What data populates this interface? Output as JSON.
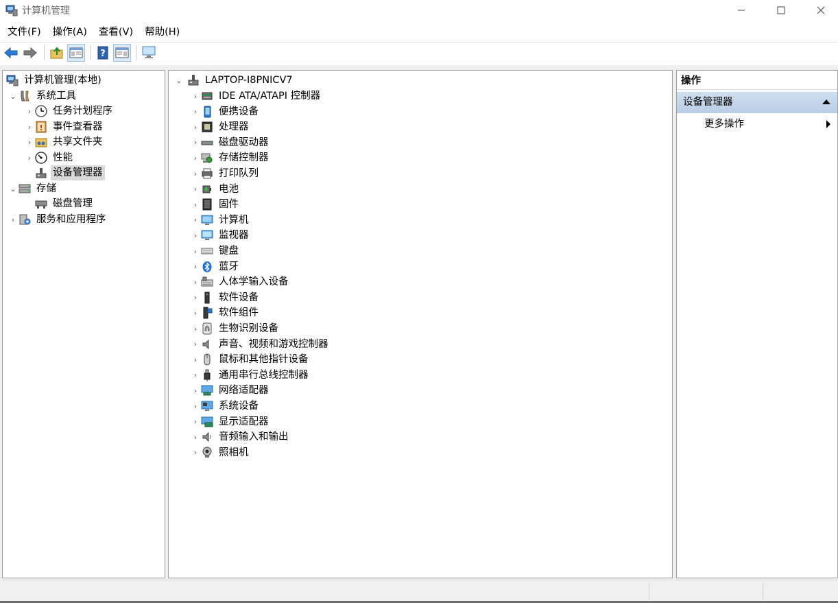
{
  "window": {
    "title": "计算机管理",
    "controls": {
      "minimize": "—",
      "maximize": "☐",
      "close": "✕"
    }
  },
  "menu": {
    "items": [
      "文件(F)",
      "操作(A)",
      "查看(V)",
      "帮助(H)"
    ]
  },
  "toolbar": {
    "buttons": [
      "back-icon",
      "forward-icon",
      "up-folder-icon",
      "show-hide-tree-icon",
      "help-icon",
      "action-pane-icon",
      "monitor-icon"
    ]
  },
  "left_tree": {
    "root": "计算机管理(本地)",
    "system_tools": "系统工具",
    "task_scheduler": "任务计划程序",
    "event_viewer": "事件查看器",
    "shared_folders": "共享文件夹",
    "performance": "性能",
    "device_manager": "设备管理器",
    "storage": "存储",
    "disk_management": "磁盘管理",
    "services_apps": "服务和应用程序"
  },
  "device_tree": {
    "computer_name": "LAPTOP-I8PNICV7",
    "categories": [
      "IDE ATA/ATAPI 控制器",
      "便携设备",
      "处理器",
      "磁盘驱动器",
      "存储控制器",
      "打印队列",
      "电池",
      "固件",
      "计算机",
      "监视器",
      "键盘",
      "蓝牙",
      "人体学输入设备",
      "软件设备",
      "软件组件",
      "生物识别设备",
      "声音、视频和游戏控制器",
      "鼠标和其他指针设备",
      "通用串行总线控制器",
      "网络适配器",
      "系统设备",
      "显示适配器",
      "音频输入和输出",
      "照相机"
    ]
  },
  "actions": {
    "header": "操作",
    "section": "设备管理器",
    "more": "更多操作"
  },
  "colors": {
    "accent_blue": "#2a7ad5",
    "selection": "#d9d9d9",
    "actions_section": "#c4d6ea"
  }
}
